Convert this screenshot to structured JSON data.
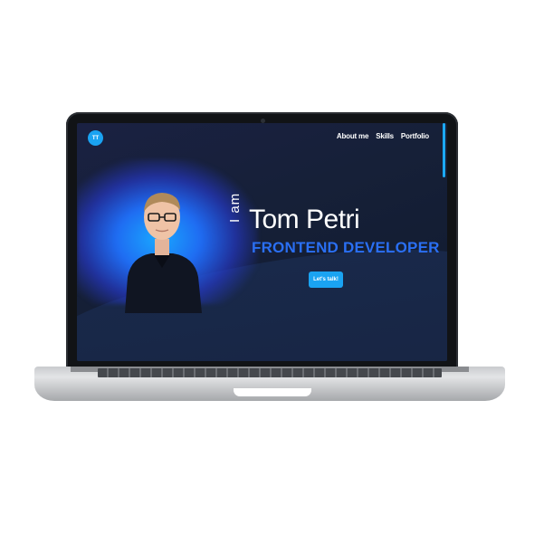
{
  "site": {
    "logo_text": "TT",
    "nav": [
      "About me",
      "Skills",
      "Portfolio"
    ]
  },
  "hero": {
    "prefix": "I am",
    "name": "Tom Petri",
    "role": "FRONTEND DEVELOPER",
    "cta_label": "Let's talk!"
  },
  "colors": {
    "accent": "#1aa3f2",
    "role": "#2a6ff3",
    "background": "#162038"
  }
}
